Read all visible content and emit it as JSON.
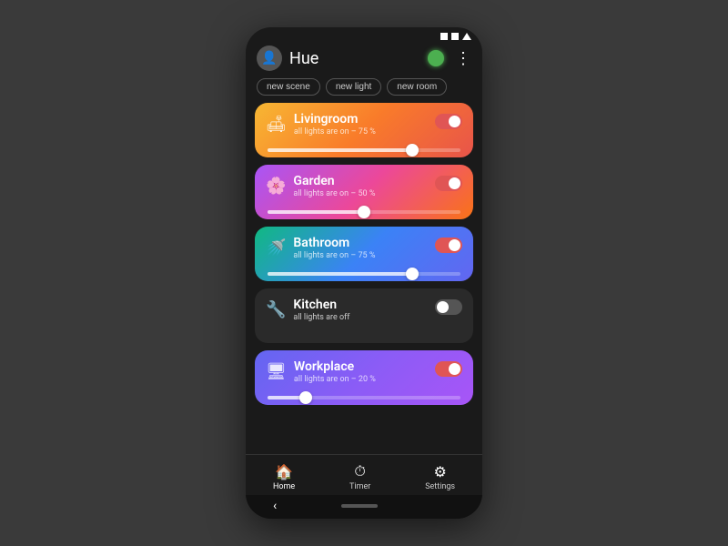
{
  "app": {
    "title": "Hue",
    "statusBar": {
      "icons": [
        "square",
        "square",
        "triangle"
      ]
    }
  },
  "header": {
    "avatar_icon": "person",
    "power_color": "#4caf50"
  },
  "actions": {
    "buttons": [
      "new scene",
      "new light",
      "new room"
    ]
  },
  "rooms": [
    {
      "id": "livingroom",
      "name": "Livingroom",
      "status": "all lights are on – 75 %",
      "icon": "🛋",
      "gradient_class": "card-livingroom",
      "toggle_on": true,
      "slider_pct": 75
    },
    {
      "id": "garden",
      "name": "Garden",
      "status": "all lights are on – 50 %",
      "icon": "🌸",
      "gradient_class": "card-garden",
      "toggle_on": true,
      "slider_pct": 50
    },
    {
      "id": "bathroom",
      "name": "Bathroom",
      "status": "all lights are on – 75 %",
      "icon": "🚿",
      "gradient_class": "card-bathroom",
      "toggle_on": true,
      "slider_pct": 75
    },
    {
      "id": "kitchen",
      "name": "Kitchen",
      "status": "all lights are off",
      "icon": "🔧",
      "gradient_class": "card-kitchen",
      "toggle_on": false,
      "slider_pct": null
    },
    {
      "id": "workplace",
      "name": "Workplace",
      "status": "all lights are on – 20 %",
      "icon": "🖥",
      "gradient_class": "card-workplace",
      "toggle_on": true,
      "slider_pct": 20
    }
  ],
  "bottomNav": {
    "items": [
      {
        "id": "home",
        "label": "Home",
        "icon": "🏠",
        "active": true
      },
      {
        "id": "timer",
        "label": "Timer",
        "icon": "⏱",
        "active": false
      },
      {
        "id": "settings",
        "label": "Settings",
        "icon": "⚙",
        "active": false
      }
    ]
  }
}
